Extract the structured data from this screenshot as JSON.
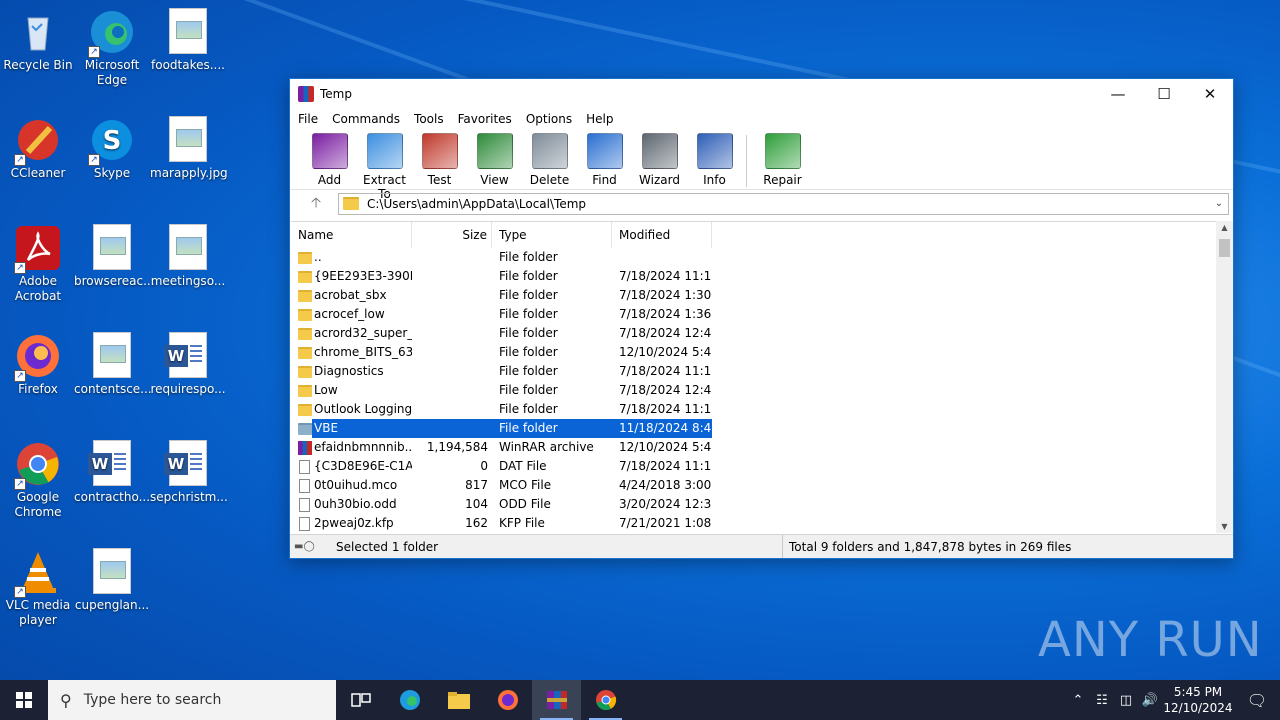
{
  "desktop": {
    "icons": [
      {
        "label": "Recycle Bin",
        "icon": "recycle-bin-icon"
      },
      {
        "label": "Microsoft Edge",
        "icon": "edge-icon"
      },
      {
        "label": "foodtakes....",
        "icon": "image-file-icon"
      },
      {
        "label": "CCleaner",
        "icon": "ccleaner-icon"
      },
      {
        "label": "Skype",
        "icon": "skype-icon"
      },
      {
        "label": "marapply.jpg",
        "icon": "image-file-icon"
      },
      {
        "label": "Adobe Acrobat",
        "icon": "acrobat-icon"
      },
      {
        "label": "browsereac...",
        "icon": "image-file-icon"
      },
      {
        "label": "meetingso...",
        "icon": "image-file-icon"
      },
      {
        "label": "Firefox",
        "icon": "firefox-icon"
      },
      {
        "label": "contentsce...",
        "icon": "image-file-icon"
      },
      {
        "label": "requirespo...",
        "icon": "word-file-icon"
      },
      {
        "label": "Google Chrome",
        "icon": "chrome-icon"
      },
      {
        "label": "contractho...",
        "icon": "word-file-icon"
      },
      {
        "label": "sepchristm...",
        "icon": "word-file-icon"
      },
      {
        "label": "VLC media player",
        "icon": "vlc-icon"
      },
      {
        "label": "cupenglan...",
        "icon": "image-file-icon"
      }
    ],
    "watermark": "ANY RUN"
  },
  "window": {
    "title": "Temp",
    "menu": [
      "File",
      "Commands",
      "Tools",
      "Favorites",
      "Options",
      "Help"
    ],
    "toolbar": [
      {
        "label": "Add",
        "icon": "add-archive-icon",
        "color": "#7b1fa2"
      },
      {
        "label": "Extract To",
        "icon": "extract-folder-icon",
        "color": "#3c8fe0"
      },
      {
        "label": "Test",
        "icon": "test-clipboard-icon",
        "color": "#c0392b"
      },
      {
        "label": "View",
        "icon": "view-book-icon",
        "color": "#2e8b3a"
      },
      {
        "label": "Delete",
        "icon": "trash-icon",
        "color": "#7f8c99"
      },
      {
        "label": "Find",
        "icon": "magnifier-icon",
        "color": "#2a6fd1"
      },
      {
        "label": "Wizard",
        "icon": "wand-icon",
        "color": "#5e6770"
      },
      {
        "label": "Info",
        "icon": "info-icon",
        "color": "#2f5fb7"
      },
      {
        "label": "Repair",
        "icon": "repair-icon",
        "color": "#2f9e3a"
      }
    ],
    "address": "C:\\Users\\admin\\AppData\\Local\\Temp",
    "columns": {
      "name": "Name",
      "size": "Size",
      "type": "Type",
      "modified": "Modified"
    },
    "rows": [
      {
        "name": "..",
        "size": "",
        "type": "File folder",
        "modified": "",
        "kind": "folder"
      },
      {
        "name": "{9EE293E3-390D...",
        "size": "",
        "type": "File folder",
        "modified": "7/18/2024 11:1...",
        "kind": "folder"
      },
      {
        "name": "acrobat_sbx",
        "size": "",
        "type": "File folder",
        "modified": "7/18/2024 1:30 ...",
        "kind": "folder"
      },
      {
        "name": "acrocef_low",
        "size": "",
        "type": "File folder",
        "modified": "7/18/2024 1:36 ...",
        "kind": "folder"
      },
      {
        "name": "acrord32_super_...",
        "size": "",
        "type": "File folder",
        "modified": "7/18/2024 12:4...",
        "kind": "folder"
      },
      {
        "name": "chrome_BITS_63...",
        "size": "",
        "type": "File folder",
        "modified": "12/10/2024 5:4...",
        "kind": "folder"
      },
      {
        "name": "Diagnostics",
        "size": "",
        "type": "File folder",
        "modified": "7/18/2024 11:1...",
        "kind": "folder"
      },
      {
        "name": "Low",
        "size": "",
        "type": "File folder",
        "modified": "7/18/2024 12:4...",
        "kind": "folder"
      },
      {
        "name": "Outlook Logging",
        "size": "",
        "type": "File folder",
        "modified": "7/18/2024 11:1...",
        "kind": "folder"
      },
      {
        "name": "VBE",
        "size": "",
        "type": "File folder",
        "modified": "11/18/2024 8:4...",
        "kind": "folder",
        "selected": true
      },
      {
        "name": "efaidnbmnnnib...",
        "size": "1,194,584",
        "type": "WinRAR archive",
        "modified": "12/10/2024 5:4...",
        "kind": "rar"
      },
      {
        "name": "{C3D8E96E-C1A...",
        "size": "0",
        "type": "DAT File",
        "modified": "7/18/2024 11:1...",
        "kind": "file"
      },
      {
        "name": "0t0uihud.mco",
        "size": "817",
        "type": "MCO File",
        "modified": "4/24/2018 3:00 ...",
        "kind": "file"
      },
      {
        "name": "0uh30bio.odd",
        "size": "104",
        "type": "ODD File",
        "modified": "3/20/2024 12:3...",
        "kind": "file"
      },
      {
        "name": "2pweaj0z.kfp",
        "size": "162",
        "type": "KFP File",
        "modified": "7/21/2021 1:08 ...",
        "kind": "file"
      }
    ],
    "status_left": "Selected 1 folder",
    "status_right": "Total 9 folders and 1,847,878 bytes in 269 files"
  },
  "taskbar": {
    "search_placeholder": "Type here to search",
    "time": "5:45 PM",
    "date": "12/10/2024"
  }
}
